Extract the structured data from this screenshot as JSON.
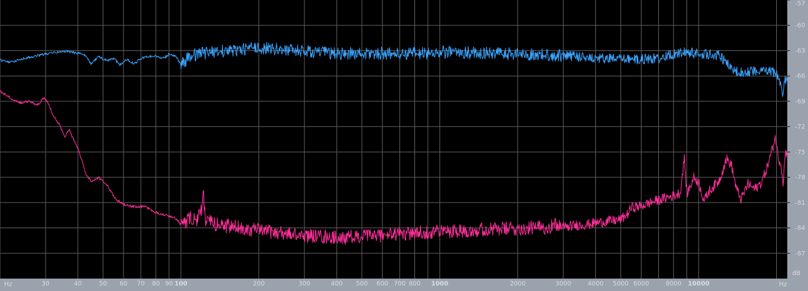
{
  "window": {
    "title": ""
  },
  "colors": {
    "background": "#000000",
    "grid": "#5a5a5a",
    "panel": "#9aa2ae",
    "series_top": "#3aa4ff",
    "series_bottom": "#ff2f9a"
  },
  "chart_data": {
    "type": "line",
    "title": "",
    "xlabel": "Hz",
    "ylabel": "dB",
    "x_scale": "log",
    "xlim": [
      20,
      22000
    ],
    "ylim": [
      -90,
      -57
    ],
    "grid": true,
    "x_ticks": [
      {
        "value": 30,
        "label": "30"
      },
      {
        "value": 40,
        "label": "40"
      },
      {
        "value": 50,
        "label": "50"
      },
      {
        "value": 60,
        "label": "60"
      },
      {
        "value": 70,
        "label": "70"
      },
      {
        "value": 80,
        "label": "80"
      },
      {
        "value": 90,
        "label": "90"
      },
      {
        "value": 100,
        "label": "100"
      },
      {
        "value": 200,
        "label": "200"
      },
      {
        "value": 300,
        "label": "300"
      },
      {
        "value": 400,
        "label": "400"
      },
      {
        "value": 500,
        "label": "500"
      },
      {
        "value": 600,
        "label": "600"
      },
      {
        "value": 700,
        "label": "700"
      },
      {
        "value": 800,
        "label": "800"
      },
      {
        "value": 1000,
        "label": "1000"
      },
      {
        "value": 2000,
        "label": "2000"
      },
      {
        "value": 3000,
        "label": "3000"
      },
      {
        "value": 4000,
        "label": "4000"
      },
      {
        "value": 5000,
        "label": "5000"
      },
      {
        "value": 6000,
        "label": "6000"
      },
      {
        "value": 8000,
        "label": "8000"
      },
      {
        "value": 10000,
        "label": "10000"
      }
    ],
    "x_unit_left": "Hz",
    "x_unit_right": "Hz",
    "y_ticks": [
      {
        "value": -57,
        "label": "-57"
      },
      {
        "value": -60,
        "label": "-60"
      },
      {
        "value": -63,
        "label": "-63"
      },
      {
        "value": -66,
        "label": "-66"
      },
      {
        "value": -69,
        "label": "-69"
      },
      {
        "value": -72,
        "label": "-72"
      },
      {
        "value": -75,
        "label": "-75"
      },
      {
        "value": -78,
        "label": "-78"
      },
      {
        "value": -81,
        "label": "-81"
      },
      {
        "value": -84,
        "label": "-84"
      },
      {
        "value": -87,
        "label": "-87"
      }
    ],
    "y_unit": "dB",
    "series": [
      {
        "color": "#3aa4ff",
        "points": [
          [
            20,
            -64.1
          ],
          [
            22,
            -64.4
          ],
          [
            24,
            -64.0
          ],
          [
            26,
            -63.8
          ],
          [
            28,
            -63.6
          ],
          [
            30,
            -63.4
          ],
          [
            33,
            -63.2
          ],
          [
            36,
            -63.1
          ],
          [
            40,
            -63.3
          ],
          [
            43,
            -63.6
          ],
          [
            45,
            -64.6
          ],
          [
            48,
            -63.7
          ],
          [
            52,
            -64.2
          ],
          [
            55,
            -63.9
          ],
          [
            58,
            -64.7
          ],
          [
            62,
            -64.0
          ],
          [
            66,
            -64.6
          ],
          [
            70,
            -63.9
          ],
          [
            75,
            -63.7
          ],
          [
            80,
            -63.6
          ],
          [
            85,
            -64.0
          ],
          [
            90,
            -63.4
          ],
          [
            95,
            -63.6
          ],
          [
            100,
            -64.6
          ],
          [
            110,
            -63.6
          ],
          [
            120,
            -63.3
          ],
          [
            135,
            -63.1
          ],
          [
            150,
            -63.0
          ],
          [
            170,
            -62.9
          ],
          [
            190,
            -62.7
          ],
          [
            210,
            -62.7
          ],
          [
            230,
            -62.8
          ],
          [
            260,
            -62.9
          ],
          [
            300,
            -63.1
          ],
          [
            350,
            -63.2
          ],
          [
            400,
            -63.4
          ],
          [
            450,
            -63.3
          ],
          [
            500,
            -63.4
          ],
          [
            600,
            -63.3
          ],
          [
            700,
            -63.4
          ],
          [
            800,
            -63.3
          ],
          [
            900,
            -63.3
          ],
          [
            1000,
            -63.2
          ],
          [
            1200,
            -63.2
          ],
          [
            1500,
            -63.3
          ],
          [
            2000,
            -63.4
          ],
          [
            2500,
            -63.5
          ],
          [
            3000,
            -63.6
          ],
          [
            3500,
            -63.7
          ],
          [
            4000,
            -63.9
          ],
          [
            5000,
            -64.0
          ],
          [
            6000,
            -64.0
          ],
          [
            7000,
            -63.9
          ],
          [
            8000,
            -63.4
          ],
          [
            9000,
            -63.2
          ],
          [
            10000,
            -63.4
          ],
          [
            11000,
            -63.4
          ],
          [
            12000,
            -63.6
          ],
          [
            12800,
            -64.4
          ],
          [
            13500,
            -65.5
          ],
          [
            15000,
            -65.5
          ],
          [
            17000,
            -65.3
          ],
          [
            19000,
            -65.5
          ],
          [
            20000,
            -65.7
          ],
          [
            20800,
            -67.0
          ],
          [
            21200,
            -68.5
          ],
          [
            21500,
            -66.5
          ],
          [
            22000,
            -66.8
          ]
        ]
      },
      {
        "color": "#ff2f9a",
        "points": [
          [
            20,
            -67.8
          ],
          [
            22,
            -68.6
          ],
          [
            24,
            -69.2
          ],
          [
            26,
            -69.0
          ],
          [
            28,
            -69.4
          ],
          [
            29.5,
            -68.6
          ],
          [
            30.5,
            -69.0
          ],
          [
            32,
            -70.6
          ],
          [
            34,
            -71.8
          ],
          [
            35.5,
            -73.2
          ],
          [
            37,
            -72.4
          ],
          [
            40,
            -74.6
          ],
          [
            43,
            -77.6
          ],
          [
            45,
            -78.6
          ],
          [
            48,
            -78.0
          ],
          [
            52,
            -79.0
          ],
          [
            56,
            -80.6
          ],
          [
            60,
            -81.2
          ],
          [
            64,
            -81.4
          ],
          [
            68,
            -81.6
          ],
          [
            72,
            -81.4
          ],
          [
            78,
            -82.0
          ],
          [
            85,
            -82.4
          ],
          [
            90,
            -82.6
          ],
          [
            95,
            -82.8
          ],
          [
            100,
            -83.6
          ],
          [
            105,
            -83.2
          ],
          [
            110,
            -82.8
          ],
          [
            115,
            -83.3
          ],
          [
            120,
            -81.9
          ],
          [
            122,
            -79.6
          ],
          [
            124,
            -83.0
          ],
          [
            130,
            -83.4
          ],
          [
            140,
            -83.6
          ],
          [
            160,
            -83.9
          ],
          [
            180,
            -84.1
          ],
          [
            200,
            -84.3
          ],
          [
            230,
            -84.5
          ],
          [
            260,
            -84.7
          ],
          [
            300,
            -84.9
          ],
          [
            340,
            -85.0
          ],
          [
            380,
            -85.1
          ],
          [
            420,
            -85.2
          ],
          [
            460,
            -85.1
          ],
          [
            500,
            -85.0
          ],
          [
            560,
            -84.9
          ],
          [
            640,
            -84.8
          ],
          [
            720,
            -84.7
          ],
          [
            800,
            -84.6
          ],
          [
            900,
            -84.5
          ],
          [
            1000,
            -84.4
          ],
          [
            1200,
            -84.3
          ],
          [
            1500,
            -84.2
          ],
          [
            1800,
            -84.1
          ],
          [
            2000,
            -84.1
          ],
          [
            2300,
            -84.0
          ],
          [
            2600,
            -83.9
          ],
          [
            2800,
            -83.6
          ],
          [
            3000,
            -83.9
          ],
          [
            3300,
            -83.7
          ],
          [
            3700,
            -83.6
          ],
          [
            4000,
            -83.4
          ],
          [
            4500,
            -83.2
          ],
          [
            5000,
            -83.0
          ],
          [
            5300,
            -82.4
          ],
          [
            5500,
            -81.6
          ],
          [
            6000,
            -81.4
          ],
          [
            6500,
            -81.0
          ],
          [
            7000,
            -80.7
          ],
          [
            7500,
            -80.4
          ],
          [
            8000,
            -80.2
          ],
          [
            8500,
            -79.8
          ],
          [
            8800,
            -75.6
          ],
          [
            9000,
            -80.0
          ],
          [
            9300,
            -79.0
          ],
          [
            9600,
            -78.0
          ],
          [
            10000,
            -78.6
          ],
          [
            10500,
            -80.8
          ],
          [
            11000,
            -79.6
          ],
          [
            12000,
            -78.4
          ],
          [
            12800,
            -75.8
          ],
          [
            13400,
            -76.6
          ],
          [
            14000,
            -79.4
          ],
          [
            14600,
            -80.6
          ],
          [
            15500,
            -78.8
          ],
          [
            16500,
            -79.4
          ],
          [
            17500,
            -78.6
          ],
          [
            18500,
            -76.6
          ],
          [
            19200,
            -74.8
          ],
          [
            19800,
            -73.2
          ],
          [
            20300,
            -75.6
          ],
          [
            20800,
            -76.4
          ],
          [
            21200,
            -78.6
          ],
          [
            21600,
            -75.2
          ],
          [
            22000,
            -75.0
          ]
        ]
      }
    ]
  }
}
